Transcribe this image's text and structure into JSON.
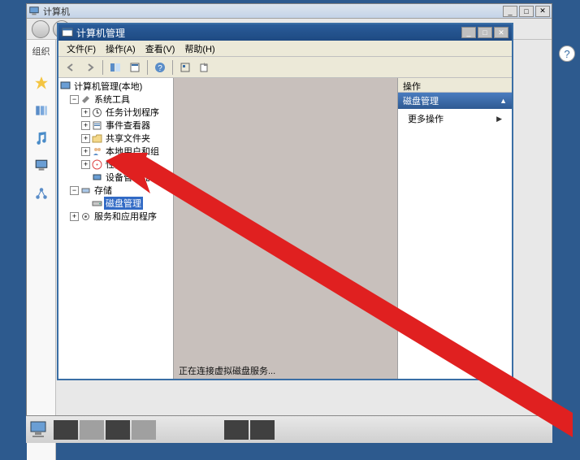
{
  "outer_window": {
    "title": "计算机"
  },
  "sidebar": {
    "label": "组织"
  },
  "inner_window": {
    "title": "计算机管理"
  },
  "menu": {
    "file": "文件(F)",
    "action": "操作(A)",
    "view": "查看(V)",
    "help": "帮助(H)"
  },
  "tree": {
    "root": "计算机管理(本地)",
    "system_tools": "系统工具",
    "task_scheduler": "任务计划程序",
    "event_viewer": "事件查看器",
    "shared_folders": "共享文件夹",
    "local_users": "本地用户和组",
    "performance": "性能",
    "device_manager": "设备管理器",
    "storage": "存储",
    "disk_management": "磁盘管理",
    "services_apps": "服务和应用程序"
  },
  "content": {
    "status": "正在连接虚拟磁盘服务..."
  },
  "actions": {
    "header": "操作",
    "section": "磁盘管理",
    "more": "更多操作"
  },
  "help_icon": "?"
}
